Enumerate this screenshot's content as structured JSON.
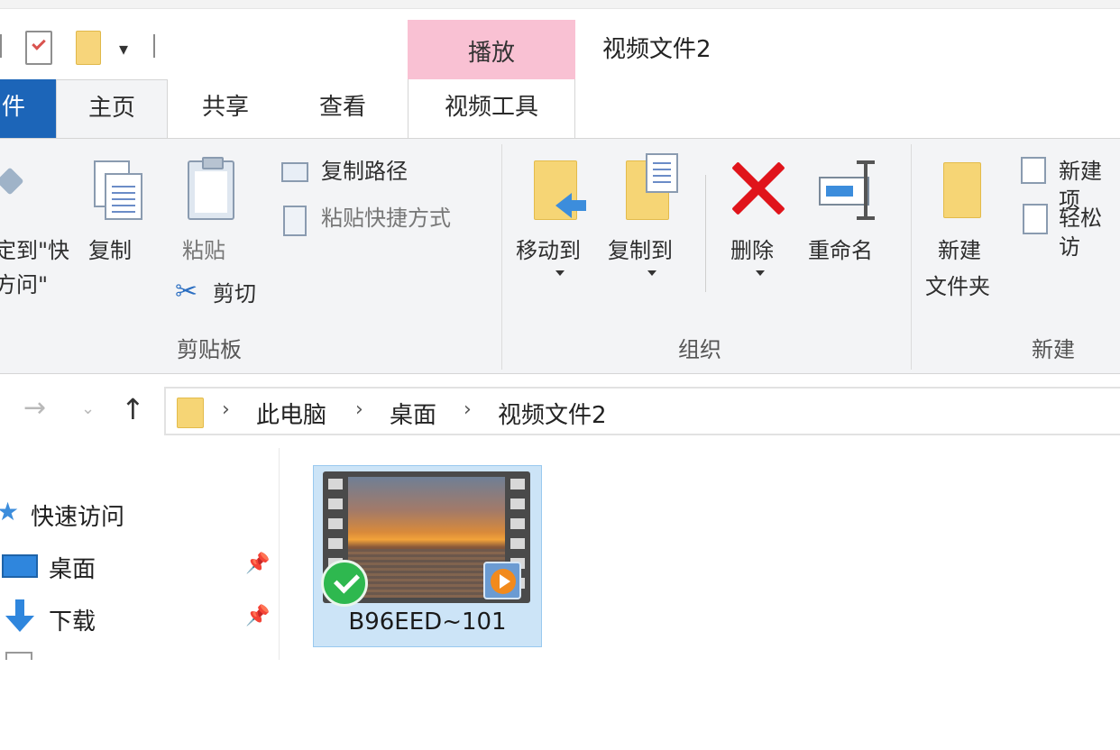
{
  "window": {
    "title": "视频文件2",
    "context_tab_header": "播放"
  },
  "tabs": {
    "file": "件",
    "home": "主页",
    "share": "共享",
    "view": "查看",
    "video_tools": "视频工具"
  },
  "ribbon": {
    "clipboard": {
      "pin_line1": "定到\"快",
      "pin_line2": "方问\"",
      "copy": "复制",
      "paste": "粘贴",
      "copy_path": "复制路径",
      "paste_shortcut": "粘贴快捷方式",
      "cut": "剪切",
      "group_label": "剪贴板"
    },
    "organize": {
      "move_to": "移动到",
      "copy_to": "复制到",
      "delete": "删除",
      "rename": "重命名",
      "group_label": "组织"
    },
    "new": {
      "new_folder_line1": "新建",
      "new_folder_line2": "文件夹",
      "new_item": "新建项",
      "easy_access": "轻松访",
      "group_label": "新建"
    }
  },
  "address": {
    "crumbs": [
      "此电脑",
      "桌面",
      "视频文件2"
    ]
  },
  "navpane": {
    "quick_access": "快速访问",
    "desktop": "桌面",
    "downloads": "下载"
  },
  "files": [
    {
      "name": "B96EED~101"
    }
  ],
  "colors": {
    "file_tab": "#1c65b8",
    "context_tab": "#f9c1d3",
    "selection": "#cce4f7",
    "delete": "#e0141b"
  }
}
